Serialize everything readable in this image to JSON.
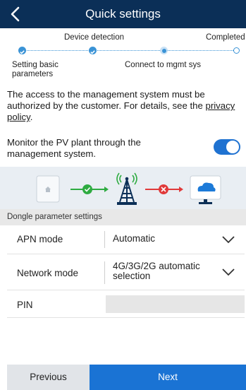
{
  "header": {
    "title": "Quick settings",
    "back_icon": "chevron-left-icon"
  },
  "progress": {
    "steps": [
      {
        "label": "Setting basic parameters",
        "state": "completed"
      },
      {
        "label": "Device detection",
        "state": "completed"
      },
      {
        "label": "Connect to mgmt sys",
        "state": "current"
      },
      {
        "label": "Completed",
        "state": "pending"
      }
    ],
    "colors": {
      "done": "#3a93d6",
      "pending_border": "#3a93d6"
    }
  },
  "intro": {
    "text": "The access to the management system must be authorized by the customer. For details, see the ",
    "link": "privacy policy",
    "suffix": "."
  },
  "monitor": {
    "label": "Monitor the PV plant through the management system.",
    "enabled": true
  },
  "diagram": {
    "nodes": [
      "dongle-device-icon",
      "cell-tower-icon",
      "cloud-server-icon"
    ],
    "links": [
      {
        "status": "connected",
        "color": "#2eab41"
      },
      {
        "status": "failed",
        "color": "#e03a3a"
      }
    ]
  },
  "section": {
    "title": "Dongle parameter settings"
  },
  "fields": {
    "apn": {
      "label": "APN mode",
      "value": "Automatic"
    },
    "network": {
      "label": "Network mode",
      "value_line1": "4G/3G/2G automatic",
      "value_line2": "selection"
    },
    "pin": {
      "label": "PIN",
      "value": ""
    }
  },
  "footer": {
    "previous": "Previous",
    "next": "Next"
  },
  "theme": {
    "header_bg": "#0b2f57",
    "accent": "#1a73d4"
  }
}
